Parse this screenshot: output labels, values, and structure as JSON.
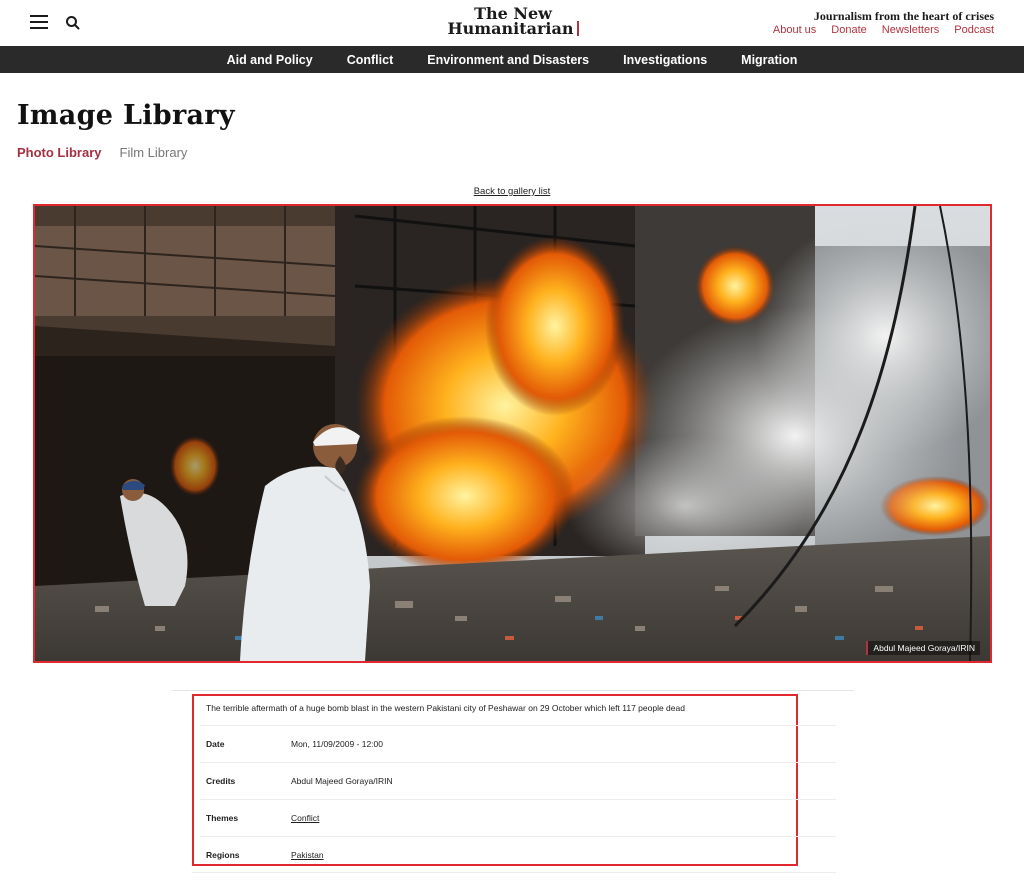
{
  "header": {
    "logo_line1": "The New",
    "logo_line2": "Humanitarian",
    "tagline": "Journalism from the heart of crises",
    "links": [
      "About us",
      "Donate",
      "Newsletters",
      "Podcast"
    ],
    "menu_icon": "hamburger-icon",
    "search_icon": "search-icon"
  },
  "nav": {
    "items": [
      "Aid and Policy",
      "Conflict",
      "Environment and Disasters",
      "Investigations",
      "Migration"
    ]
  },
  "page": {
    "title": "Image Library",
    "tabs": [
      {
        "label": "Photo Library",
        "active": true
      },
      {
        "label": "Film Library",
        "active": false
      }
    ],
    "back_link": "Back to gallery list"
  },
  "photo": {
    "credit": "Abdul Majeed Goraya/IRIN"
  },
  "details": {
    "caption": "The terrible aftermath of a huge bomb blast in the western Pakistani city of Peshawar on 29 October which left 117 people dead",
    "rows": [
      {
        "key": "Date",
        "value": "Mon, 11/09/2009 - 12:00",
        "link": false
      },
      {
        "key": "Credits",
        "value": "Abdul Majeed Goraya/IRIN",
        "link": false
      },
      {
        "key": "Themes",
        "value": "Conflict",
        "link": true
      },
      {
        "key": "Regions",
        "value": "Pakistan",
        "link": true
      }
    ]
  },
  "colors": {
    "accent": "#b0333f",
    "nav_bg": "#2a2a2a",
    "highlight_border": "#e0282e"
  }
}
